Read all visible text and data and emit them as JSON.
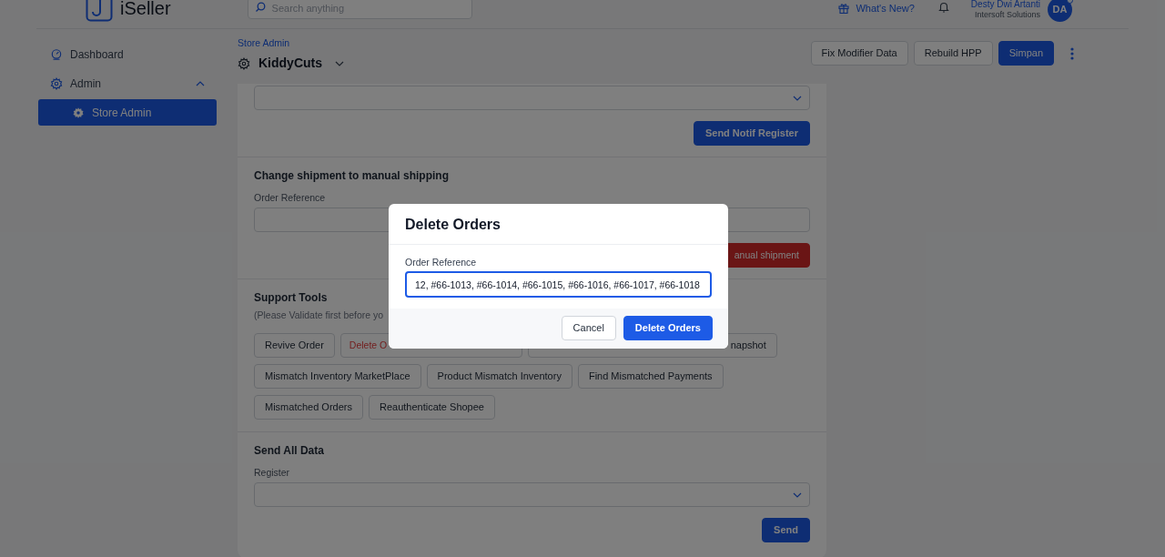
{
  "header": {
    "logo": "iSeller",
    "search": {
      "placeholder": "Search anything"
    },
    "whats_new": "What's New?",
    "user": {
      "name": "Desty Dwi Artanti",
      "company": "Intersoft Solutions",
      "initials": "DA",
      "online": true
    }
  },
  "sidebar": {
    "items": [
      {
        "label": "Dashboard",
        "selected": false
      },
      {
        "label": "Admin",
        "selected": false,
        "expanded": true,
        "children": [
          {
            "label": "Store Admin",
            "selected": true
          }
        ]
      }
    ]
  },
  "page": {
    "breadcrumb": "Store Admin",
    "title": "KiddyCuts",
    "actions": [
      {
        "label": "Fix Modifier Data",
        "kind": "secondary"
      },
      {
        "label": "Rebuild HPP",
        "kind": "secondary"
      },
      {
        "label": "Simpan",
        "kind": "primary"
      }
    ]
  },
  "sections": [
    {
      "kind": "form",
      "fields": [
        {
          "kind": "select"
        }
      ],
      "button": {
        "label": "Send Notif Register",
        "kind": "primary"
      }
    },
    {
      "kind": "form",
      "title": "Change shipment to manual shipping",
      "fields": [
        {
          "kind": "text",
          "label": "Order Reference"
        }
      ],
      "button": {
        "label": "anual shipment",
        "kind": "danger"
      }
    },
    {
      "kind": "tools",
      "title": "Support Tools",
      "note": "(Please Validate first before yo",
      "rows": [
        [
          {
            "label": "Revive Order",
            "kind": "normal"
          },
          {
            "label": "Delete O",
            "kind": "danger"
          },
          {
            "label": "napshot",
            "kind": "normal"
          }
        ],
        [
          {
            "label": "Mismatch Inventory MarketPlace",
            "kind": "normal"
          },
          {
            "label": "Product Mismatch Inventory",
            "kind": "normal"
          },
          {
            "label": "Find Mismatched Payments",
            "kind": "normal"
          }
        ],
        [
          {
            "label": "Mismatched Orders",
            "kind": "normal"
          },
          {
            "label": "Reauthenticate Shopee",
            "kind": "normal"
          }
        ]
      ]
    },
    {
      "kind": "form",
      "title": "Send All Data",
      "fields": [
        {
          "kind": "select",
          "label": "Register"
        }
      ],
      "button": {
        "label": "Send",
        "kind": "primary"
      }
    }
  ],
  "modal": {
    "title": "Delete Orders",
    "field": {
      "label": "Order Reference",
      "value": "12, #66-1013, #66-1014, #66-1015, #66-1016, #66-1017, #66-1018",
      "focused": true
    },
    "buttons": [
      {
        "label": "Cancel",
        "kind": "secondary"
      },
      {
        "label": "Delete Orders",
        "kind": "primary"
      }
    ]
  }
}
